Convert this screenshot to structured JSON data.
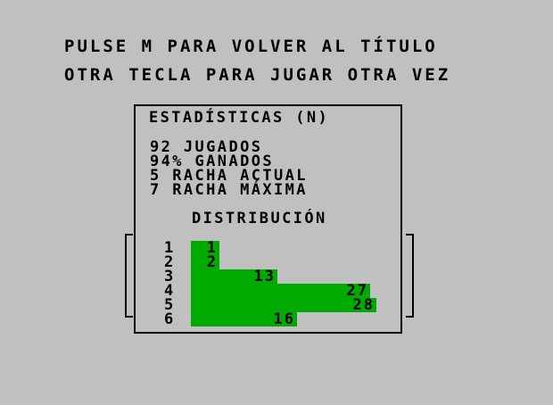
{
  "prompts": {
    "menu": "PULSE M PARA VOLVER AL TÍTULO",
    "replay": "OTRA TECLA PARA JUGAR OTRA VEZ"
  },
  "stats": {
    "title": "ESTADÍSTICAS (N)",
    "played": "92 JUGADOS",
    "won": "94% GANADOS",
    "current_streak": "5 RACHA ACTUAL",
    "max_streak": "7 RACHA MÁXIMA"
  },
  "distribution": {
    "title": "DISTRIBUCIÓN",
    "rows": [
      {
        "guess": "1",
        "count": 1
      },
      {
        "guess": "2",
        "count": 2
      },
      {
        "guess": "3",
        "count": 13
      },
      {
        "guess": "4",
        "count": 27
      },
      {
        "guess": "5",
        "count": 28
      },
      {
        "guess": "6",
        "count": 16
      }
    ],
    "bar_color": "#00aa00"
  },
  "colors": {
    "background": "#c0c0c0",
    "text": "#000000"
  }
}
